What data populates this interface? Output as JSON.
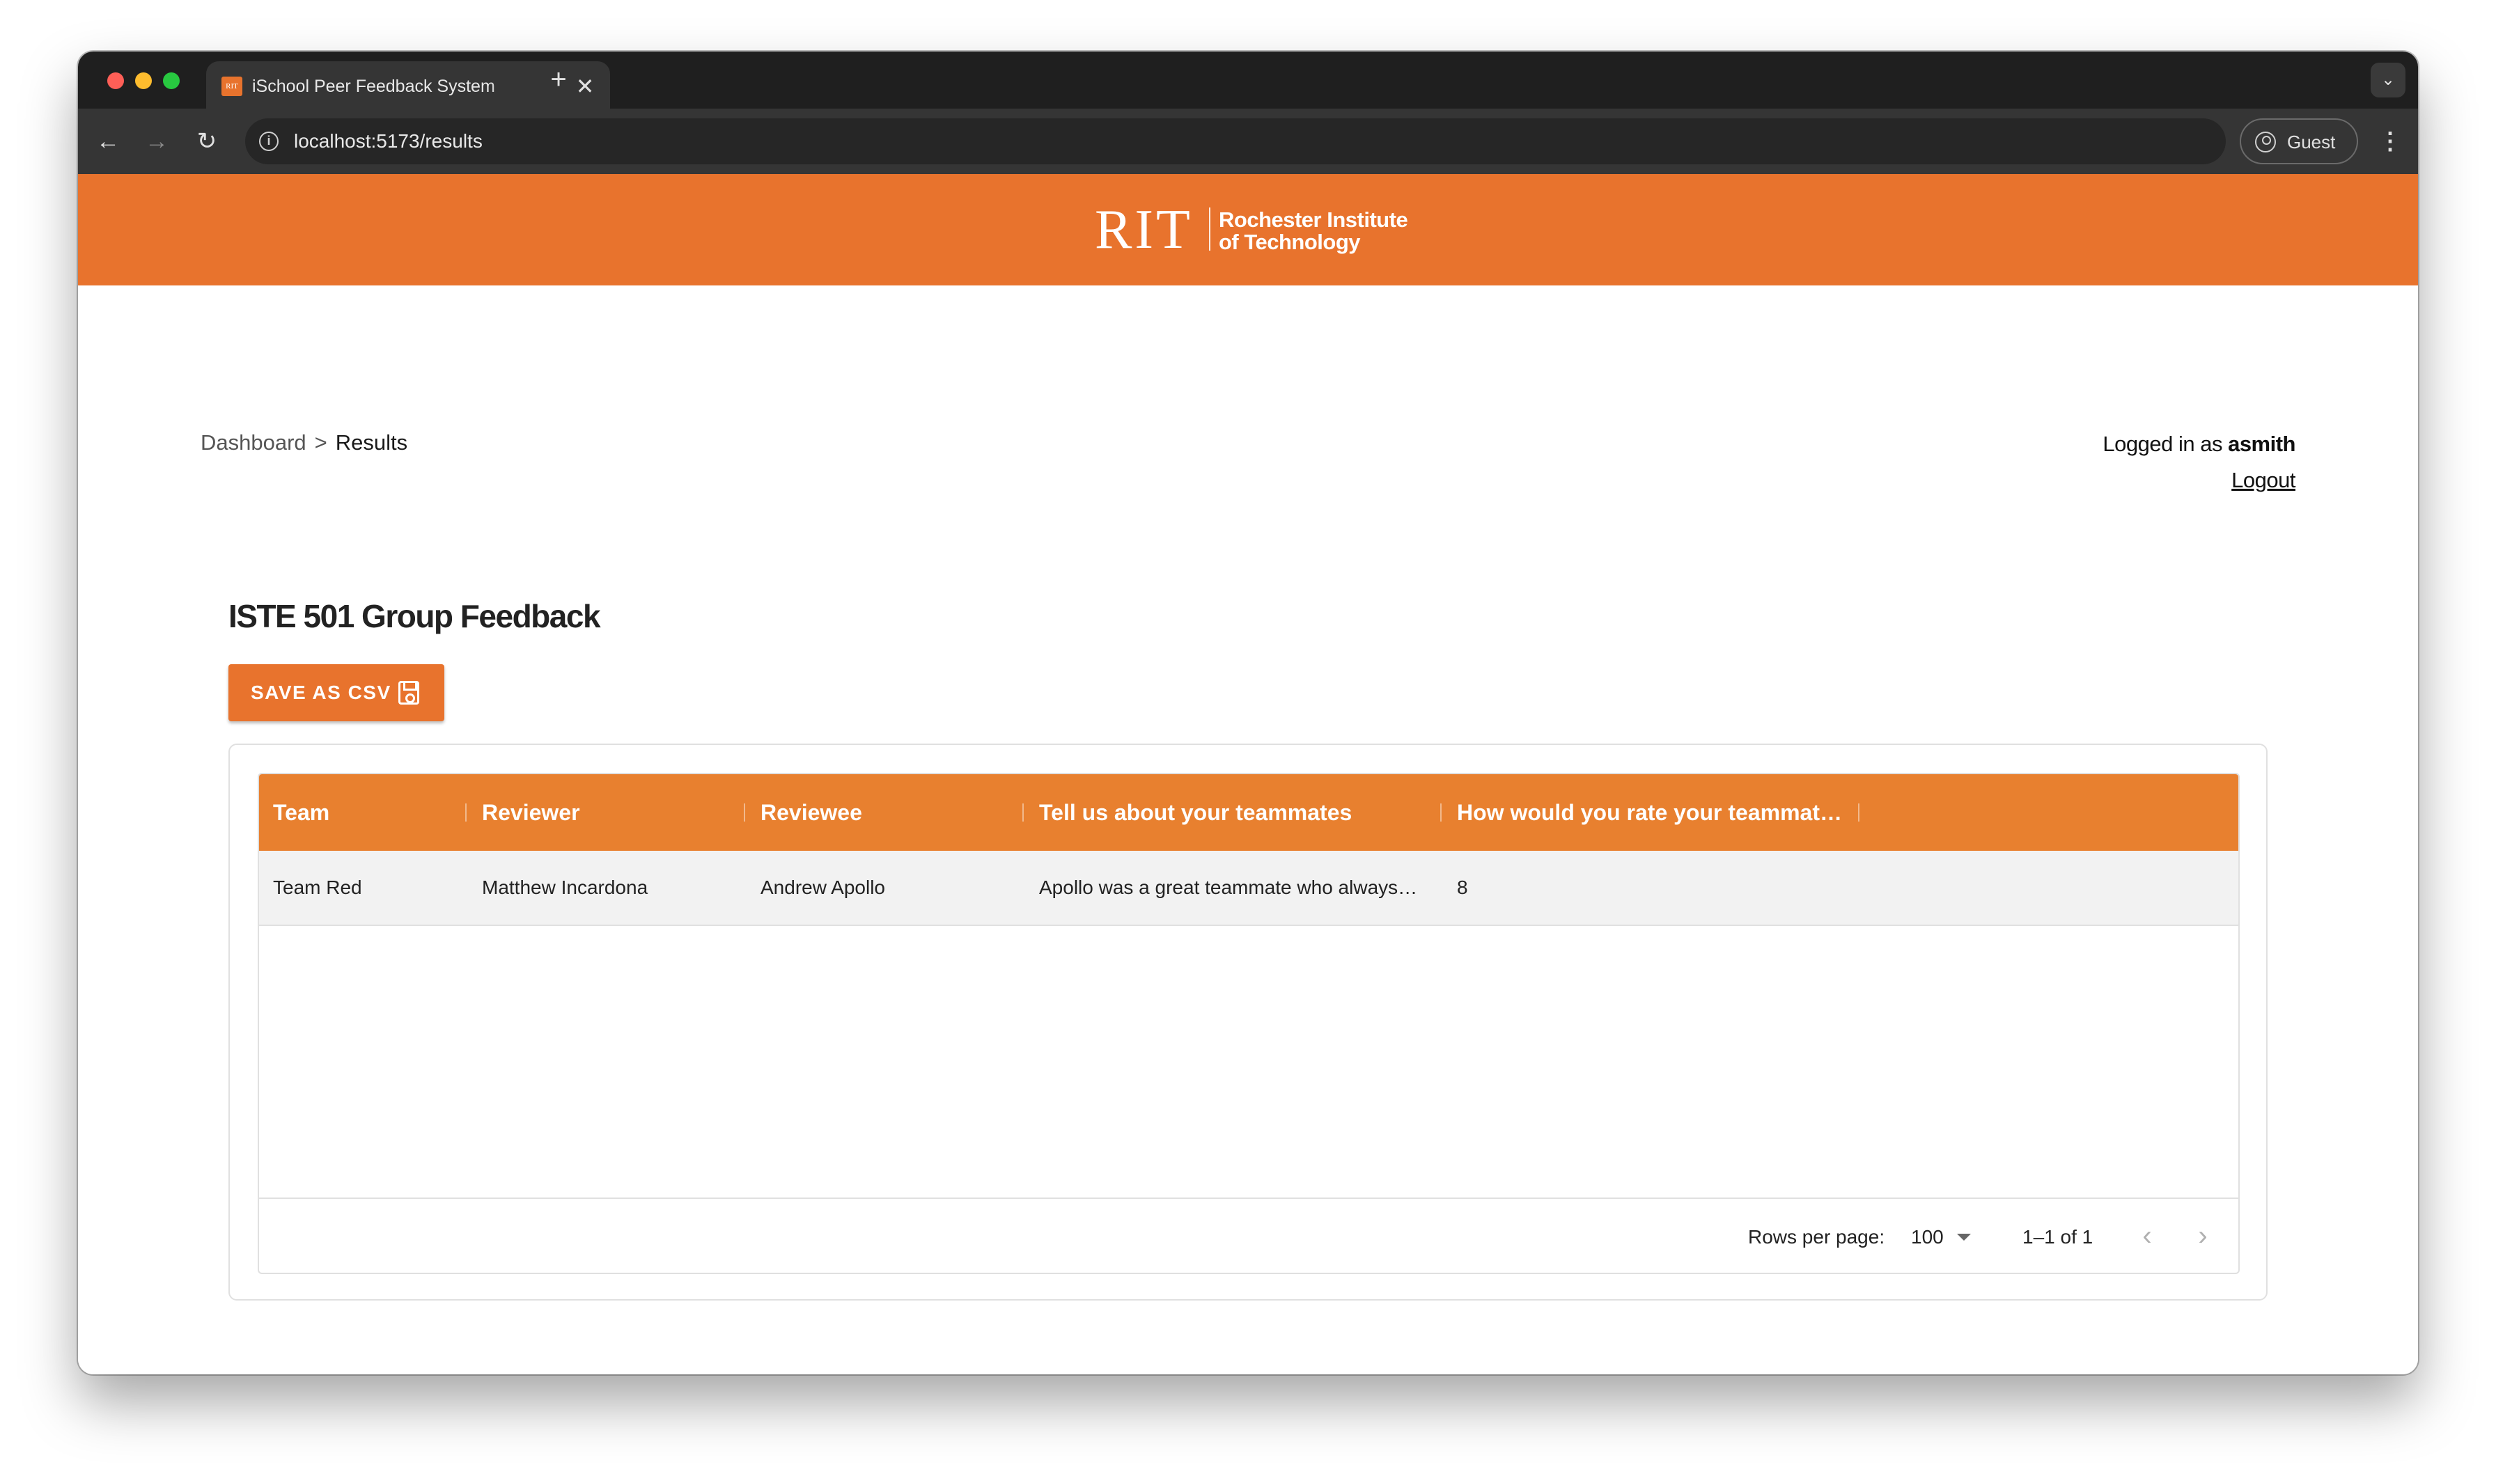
{
  "browser": {
    "tab_favicon": "RIT",
    "tab_title": "iSchool Peer Feedback System",
    "tab_close": "✕",
    "new_tab": "+",
    "tab_menu": "⌄",
    "back": "←",
    "forward": "→",
    "reload": "↻",
    "info": "i",
    "url": "localhost:5173/results",
    "profile_label": "Guest",
    "menu": "⋮"
  },
  "banner": {
    "logo_mark": "RIT",
    "logo_text_line1": "Rochester Institute",
    "logo_text_line2": "of Technology",
    "color": "#e8732d"
  },
  "breadcrumb": {
    "parent": "Dashboard",
    "separator": ">",
    "current": "Results"
  },
  "user": {
    "logged_in_prefix": "Logged in as ",
    "username": "asmith",
    "logout_label": "Logout"
  },
  "main": {
    "title": "ISTE 501 Group Feedback",
    "save_button_label": "SAVE AS CSV"
  },
  "table": {
    "columns": [
      "Team",
      "Reviewer",
      "Reviewee",
      "Tell us about your teammates",
      "How would you rate your teammat…"
    ],
    "rows": [
      [
        "Team Red",
        "Matthew Incardona",
        "Andrew Apollo",
        "Apollo was a great teammate who always…",
        "8"
      ]
    ],
    "header_color": "#e8802f"
  },
  "pagination": {
    "rows_per_page_label": "Rows per page:",
    "rows_per_page_value": "100",
    "range": "1–1 of 1",
    "prev": "‹",
    "next": "›"
  }
}
